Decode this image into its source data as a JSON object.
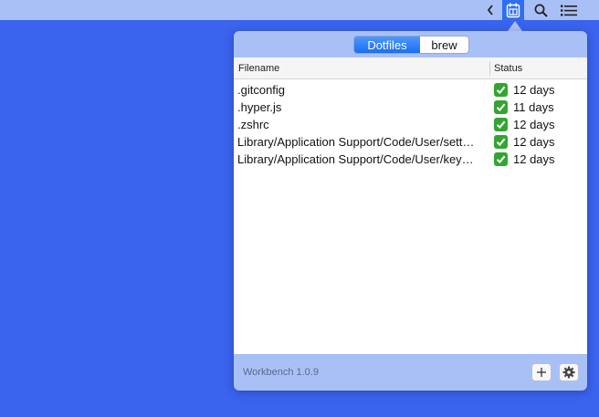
{
  "menubar": {
    "items": [
      {
        "icon": "chevron-left-icon"
      },
      {
        "icon": "workbench-app-icon"
      },
      {
        "icon": "search-icon"
      },
      {
        "icon": "list-icon"
      }
    ]
  },
  "popover": {
    "tabs": [
      {
        "label": "Dotfiles",
        "selected": true
      },
      {
        "label": "brew",
        "selected": false
      }
    ],
    "table": {
      "columns": [
        "Filename",
        "Status"
      ],
      "rows": [
        {
          "filename": ".gitconfig",
          "status": "12 days",
          "status_icon": "check-icon"
        },
        {
          "filename": ".hyper.js",
          "status": "11 days",
          "status_icon": "check-icon"
        },
        {
          "filename": ".zshrc",
          "status": "12 days",
          "status_icon": "check-icon"
        },
        {
          "filename": "Library/Application Support/Code/User/sett…",
          "status": "12 days",
          "status_icon": "check-icon"
        },
        {
          "filename": "Library/Application Support/Code/User/key…",
          "status": "12 days",
          "status_icon": "check-icon"
        }
      ]
    },
    "footer": {
      "version": "Workbench 1.0.9",
      "add_icon": "plus-icon",
      "settings_icon": "gear-icon"
    }
  },
  "colors": {
    "desktop": "#3a63ee",
    "menubar": "#a9c0f7",
    "accent": "#1a6ff2",
    "check": "#33a532"
  }
}
